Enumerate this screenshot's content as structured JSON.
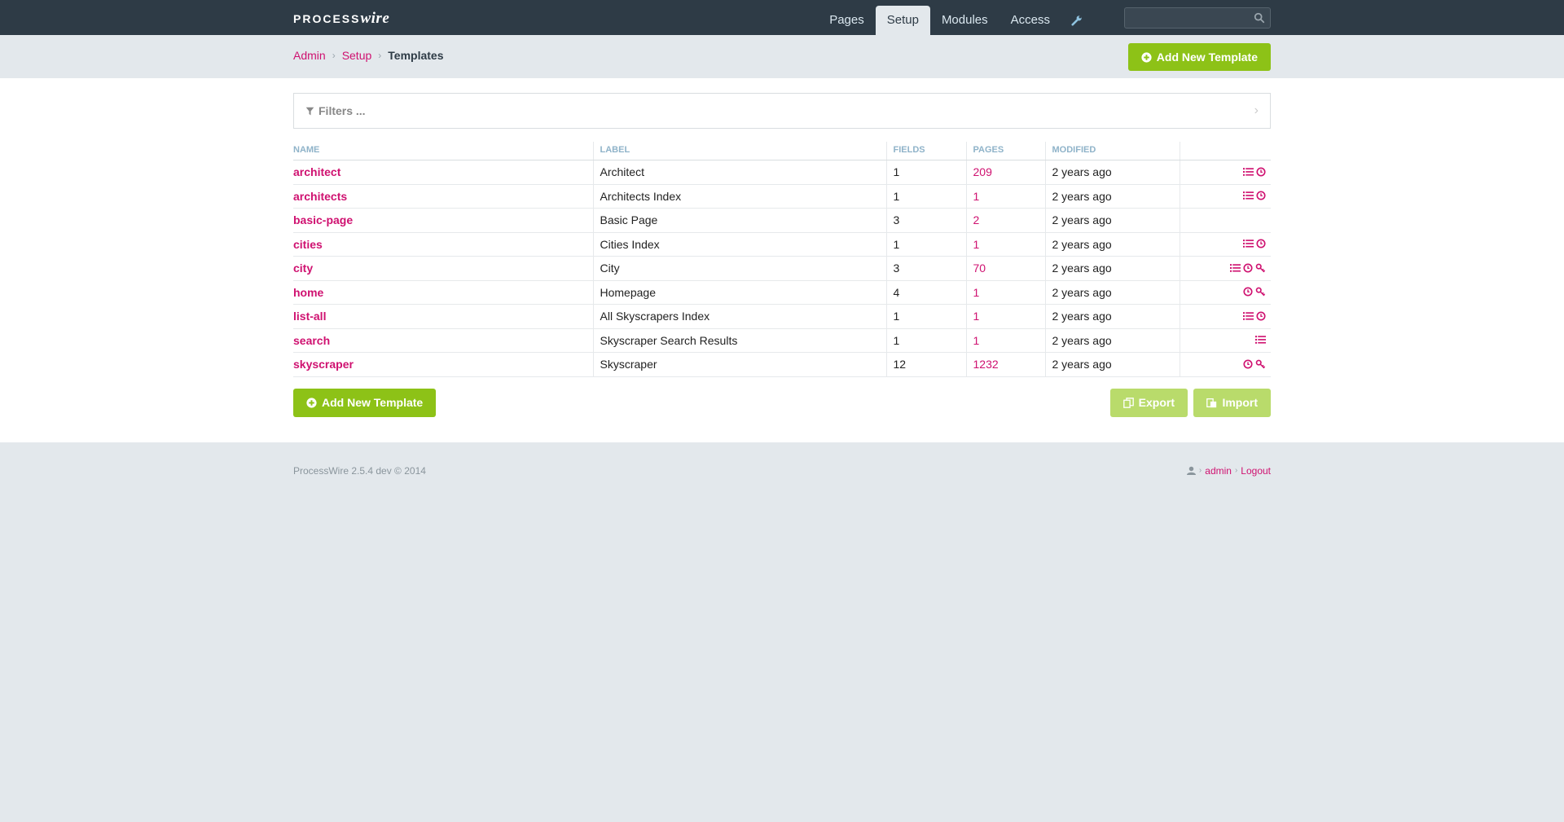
{
  "app": {
    "logo_primary": "PROCESS",
    "logo_secondary": "wire"
  },
  "topnav": {
    "items": [
      {
        "label": "Pages"
      },
      {
        "label": "Setup",
        "active": true
      },
      {
        "label": "Modules"
      },
      {
        "label": "Access"
      }
    ],
    "tools_icon": "wrench-icon",
    "search_placeholder": ""
  },
  "breadcrumb": {
    "items": [
      "Admin",
      "Setup"
    ],
    "current": "Templates"
  },
  "actions": {
    "add_new_template": "Add New Template",
    "export": "Export",
    "import": "Import"
  },
  "filters": {
    "label": "Filters ..."
  },
  "table": {
    "columns": [
      "Name",
      "Label",
      "Fields",
      "Pages",
      "Modified"
    ],
    "rows": [
      {
        "name": "architect",
        "label": "Architect",
        "fields": "1",
        "pages": "209",
        "modified": "2 years ago",
        "icons": [
          "list-icon",
          "clock-icon"
        ]
      },
      {
        "name": "architects",
        "label": "Architects Index",
        "fields": "1",
        "pages": "1",
        "modified": "2 years ago",
        "icons": [
          "list-icon",
          "clock-icon"
        ]
      },
      {
        "name": "basic-page",
        "label": "Basic Page",
        "fields": "3",
        "pages": "2",
        "modified": "2 years ago",
        "icons": []
      },
      {
        "name": "cities",
        "label": "Cities Index",
        "fields": "1",
        "pages": "1",
        "modified": "2 years ago",
        "icons": [
          "list-icon",
          "clock-icon"
        ]
      },
      {
        "name": "city",
        "label": "City",
        "fields": "3",
        "pages": "70",
        "modified": "2 years ago",
        "icons": [
          "list-icon",
          "clock-icon",
          "key-icon"
        ]
      },
      {
        "name": "home",
        "label": "Homepage",
        "fields": "4",
        "pages": "1",
        "modified": "2 years ago",
        "icons": [
          "clock-icon",
          "key-icon"
        ]
      },
      {
        "name": "list-all",
        "label": "All Skyscrapers Index",
        "fields": "1",
        "pages": "1",
        "modified": "2 years ago",
        "icons": [
          "list-icon",
          "clock-icon"
        ]
      },
      {
        "name": "search",
        "label": "Skyscraper Search Results",
        "fields": "1",
        "pages": "1",
        "modified": "2 years ago",
        "icons": [
          "list-icon"
        ]
      },
      {
        "name": "skyscraper",
        "label": "Skyscraper",
        "fields": "12",
        "pages": "1232",
        "modified": "2 years ago",
        "icons": [
          "clock-icon",
          "key-icon"
        ]
      }
    ]
  },
  "footer": {
    "copyright": "ProcessWire 2.5.4 dev © 2014",
    "user": "admin",
    "logout": "Logout"
  },
  "colors": {
    "masthead": "#2e3b46",
    "accent": "#cf1170",
    "button": "#8dc217",
    "button_light": "#b9db6b",
    "background": "#e3e8ec"
  }
}
